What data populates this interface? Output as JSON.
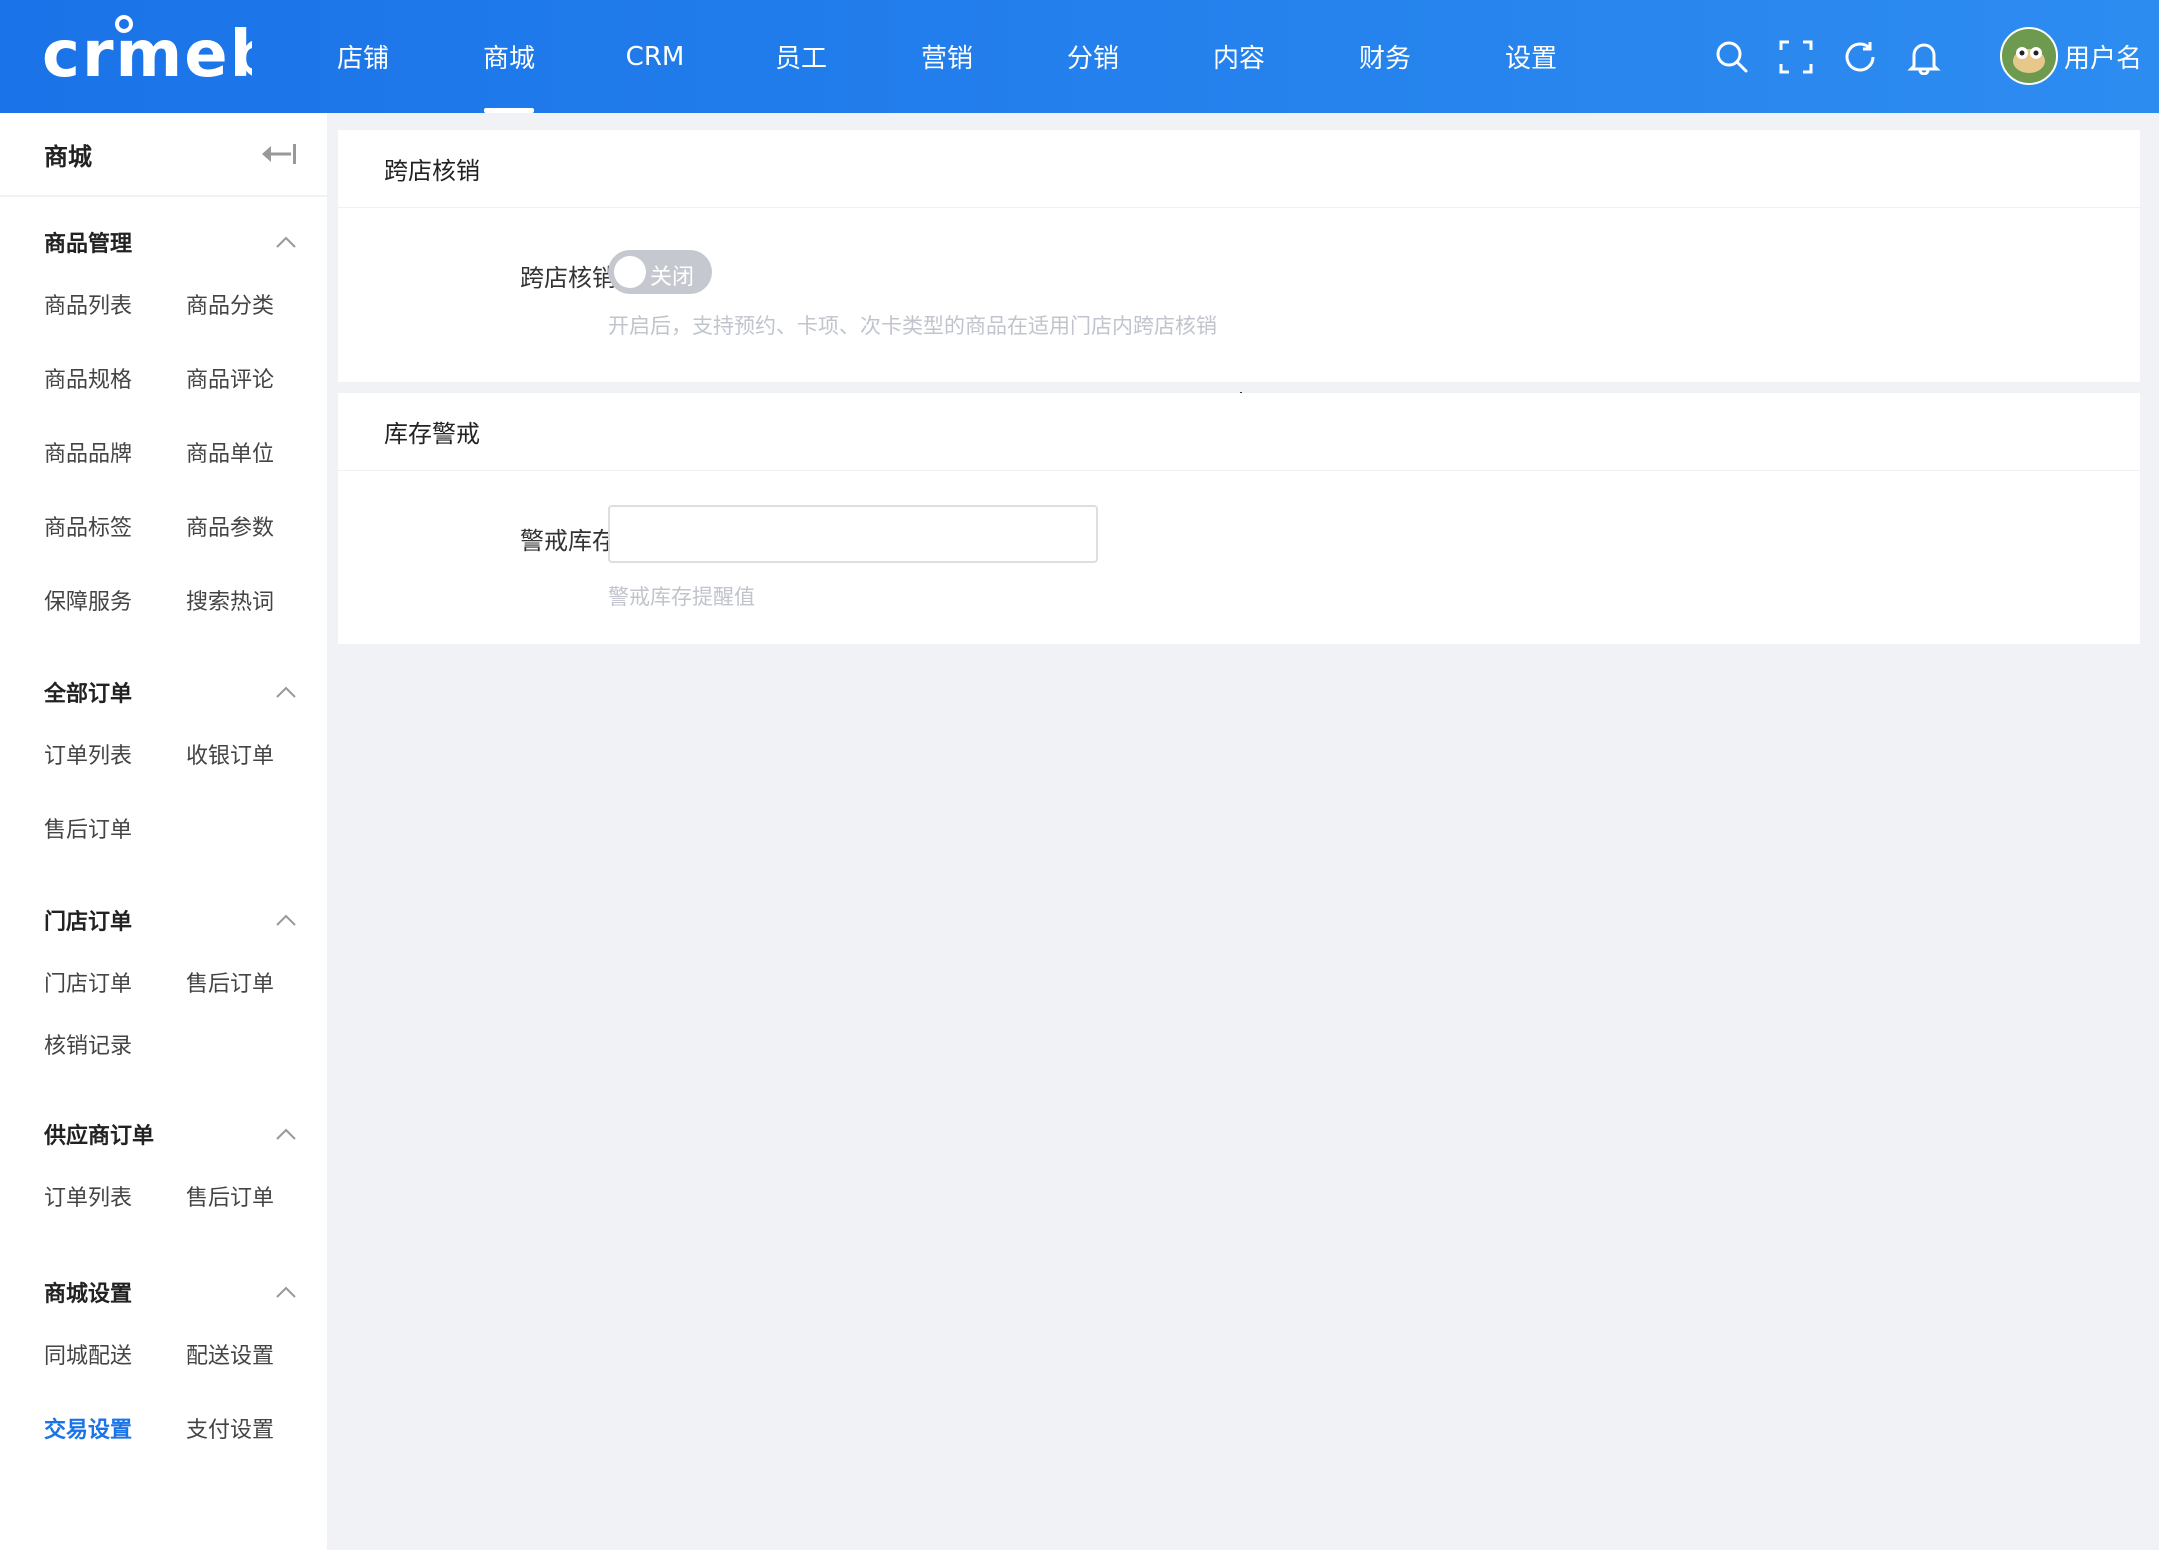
{
  "header": {
    "logo_text": "crmeb",
    "nav": [
      "店铺",
      "商城",
      "CRM",
      "员工",
      "营销",
      "分销",
      "内容",
      "财务",
      "设置"
    ],
    "active_nav": 1,
    "icons": [
      "search-icon",
      "fullscreen-icon",
      "refresh-icon",
      "bell-icon"
    ],
    "username": "用户名"
  },
  "sidebar": {
    "title": "商城",
    "groups": [
      {
        "title": "商品管理",
        "items": [
          "商品列表",
          "商品分类",
          "商品规格",
          "商品评论",
          "商品品牌",
          "商品单位",
          "商品标签",
          "商品参数",
          "保障服务",
          "搜索热词"
        ]
      },
      {
        "title": "全部订单",
        "items": [
          "订单列表",
          "收银订单",
          "售后订单"
        ]
      },
      {
        "title": "门店订单",
        "items": [
          "门店订单",
          "售后订单",
          "核销记录"
        ]
      },
      {
        "title": "供应商订单",
        "items": [
          "订单列表",
          "售后订单"
        ]
      },
      {
        "title": "商城设置",
        "items": [
          "同城配送",
          "配送设置",
          "交易设置",
          "支付设置"
        ]
      }
    ],
    "active_item": "交易设置"
  },
  "main": {
    "section1": {
      "title": "跨店核销",
      "label": "跨店核销",
      "switch_text": "关闭",
      "switch_on": false,
      "help": "开启后，支持预约、卡项、次卡类型的商品在适用门店内跨店核销"
    },
    "section2": {
      "title": "库存警戒",
      "label": "警戒库存",
      "value": "",
      "help": "警戒库存提醒值"
    }
  },
  "colors": {
    "header_start": "#1a73e8",
    "header_end": "#2d8cf0",
    "active": "#1a73e8",
    "switch_off": "#c5c8ce"
  }
}
